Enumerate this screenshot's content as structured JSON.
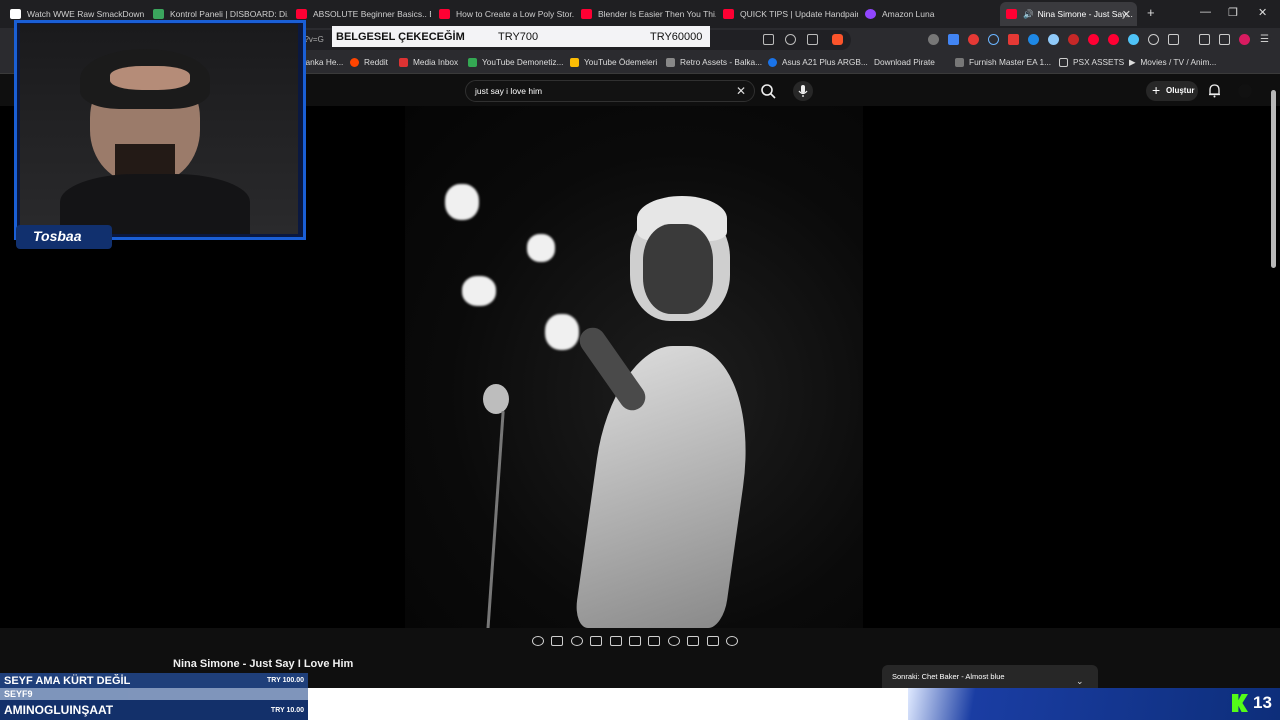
{
  "tabs": [
    {
      "label": "Watch WWE Raw SmackDown...",
      "color": "#ffffff"
    },
    {
      "label": "Kontrol Paneli | DISBOARD: Di...",
      "color": "#3ba55d"
    },
    {
      "label": "ABSOLUTE Beginner Basics.. Bl...",
      "color": "#ff0033"
    },
    {
      "label": "How to Create a Low Poly Stor...",
      "color": "#ff0033"
    },
    {
      "label": "Blender Is Easier Then You Thi...",
      "color": "#ff0033"
    },
    {
      "label": "QUICK TIPS | Update Handpain...",
      "color": "#ff0033"
    },
    {
      "label": "Amazon Luna",
      "color": "#9146ff"
    },
    {
      "label": "Nina Simone - Just Say...",
      "color": "#ff0033"
    }
  ],
  "url_fragment": "h?v=G",
  "bookmarks": [
    {
      "label": "Banka He...",
      "color": "#444"
    },
    {
      "label": "Reddit",
      "color": "#ff4500"
    },
    {
      "label": "Media Inbox",
      "color": "#d33"
    },
    {
      "label": "YouTube Demonetiz...",
      "color": "#34a853"
    },
    {
      "label": "YouTube Ödemeleri",
      "color": "#fbbc04"
    },
    {
      "label": "Retro Assets - Balka...",
      "color": "#888"
    },
    {
      "label": "Asus A21 Plus ARGB...",
      "color": "#1a73e8"
    },
    {
      "label": "Download Pirate",
      "color": "#555"
    },
    {
      "label": "Furnish Master EA 1...",
      "color": "#777"
    },
    {
      "label": "PSX ASSETS",
      "color": "#999"
    },
    {
      "label": "Movies / TV / Anim...",
      "color": "#999"
    }
  ],
  "youtube": {
    "search_value": "just say i love him",
    "create_label": "Oluştur",
    "video_title": "Nina Simone - Just Say I Love Him",
    "next_label": "Sonraki:",
    "next_title": "Chet Baker - Almost blue"
  },
  "stream_overlay": {
    "streamer_name": "Tosbaa",
    "donation_title": "BELGESEL ÇEKECEĞİM",
    "donation_current": "TRY700",
    "donation_goal": "TRY60000",
    "donors": [
      {
        "name": "SEYF AMA KÜRT DEĞİL",
        "amount": "TRY 100.00"
      },
      {
        "name": "SEYF9",
        "amount": ""
      },
      {
        "name": "AMINOGLUINŞAAT",
        "amount": "TRY 10.00"
      }
    ],
    "viewer_count": "13",
    "kick_color": "#53fc18"
  }
}
